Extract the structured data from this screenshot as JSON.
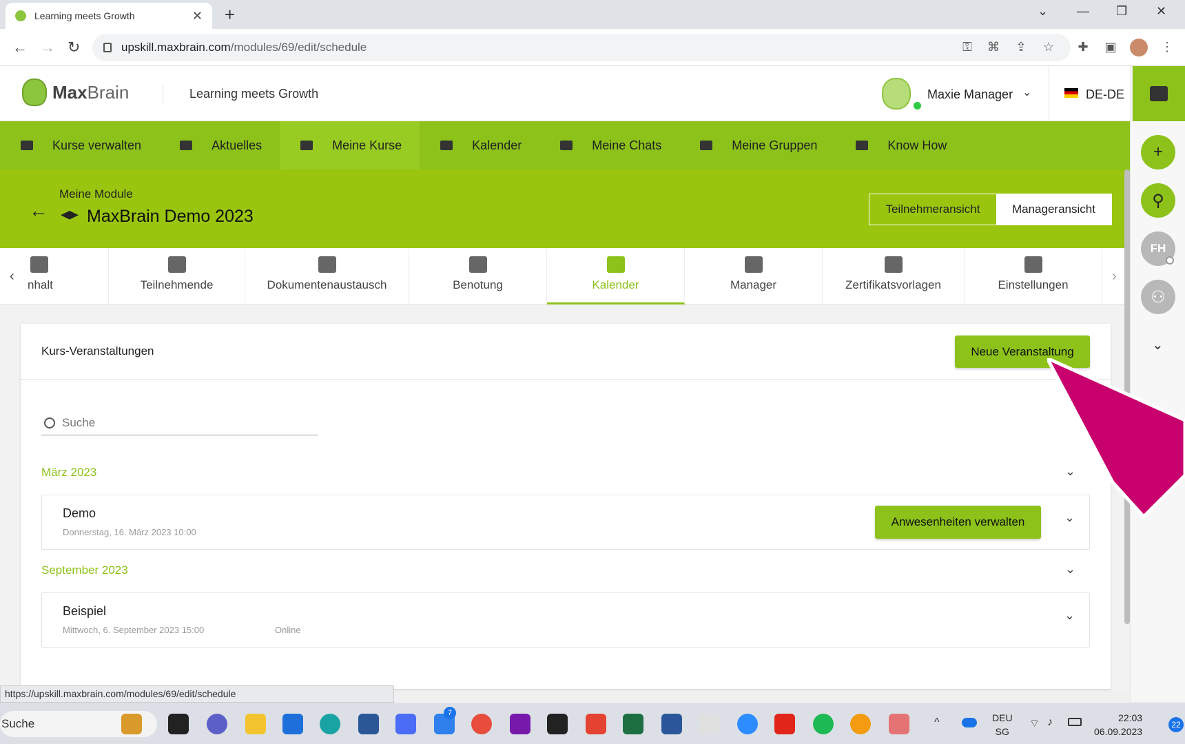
{
  "browser": {
    "tab_title": "Learning meets Growth",
    "url_host": "upskill.maxbrain.com",
    "url_path": "/modules/69/edit/schedule",
    "status_url": "https://upskill.maxbrain.com/modules/69/edit/schedule"
  },
  "header": {
    "logo_bold": "Max",
    "logo_light": "Brain",
    "tagline": "Learning meets Growth",
    "user_name": "Maxie Manager",
    "language": "DE-DE"
  },
  "mainnav": [
    {
      "label": "Kurse verwalten"
    },
    {
      "label": "Aktuelles"
    },
    {
      "label": "Meine Kurse"
    },
    {
      "label": "Kalender"
    },
    {
      "label": "Meine Chats"
    },
    {
      "label": "Meine Gruppen"
    },
    {
      "label": "Know How"
    }
  ],
  "module": {
    "breadcrumb": "Meine Module",
    "title": "MaxBrain Demo 2023",
    "view_participant": "Teilnehmeransicht",
    "view_manager": "Manageransicht"
  },
  "subtabs": [
    {
      "label": "nhalt",
      "icon": "folder-icon"
    },
    {
      "label": "Teilnehmende",
      "icon": "people-icon"
    },
    {
      "label": "Dokumentenaustausch",
      "icon": "document-share-icon"
    },
    {
      "label": "Benotung",
      "icon": "grade-icon"
    },
    {
      "label": "Kalender",
      "icon": "calendar-icon"
    },
    {
      "label": "Manager",
      "icon": "manager-icon"
    },
    {
      "label": "Zertifikatsvorlagen",
      "icon": "certificate-icon"
    },
    {
      "label": "Einstellungen",
      "icon": "settings-icon"
    }
  ],
  "events": {
    "title": "Kurs-Veranstaltungen",
    "new_button": "Neue Veranstaltung",
    "search_placeholder": "Suche",
    "groups": [
      {
        "month": "März 2023",
        "items": [
          {
            "name": "Demo",
            "date": "Donnerstag, 16. März 2023 10:00",
            "location": "",
            "action": "Anwesenheiten verwalten"
          }
        ]
      },
      {
        "month": "September 2023",
        "items": [
          {
            "name": "Beispiel",
            "date": "Mittwoch, 6. September 2023 15:00",
            "location": "Online"
          }
        ]
      }
    ]
  },
  "sidebar": {
    "initials": "FH"
  },
  "taskbar": {
    "search": "Suche",
    "lang_top": "DEU",
    "lang_bottom": "SG",
    "time": "22:03",
    "date": "06.09.2023",
    "notifications": "22",
    "todo_badge": "7"
  },
  "colors": {
    "brand_green": "#8cc21a",
    "pointer_magenta": "#c8006e"
  }
}
